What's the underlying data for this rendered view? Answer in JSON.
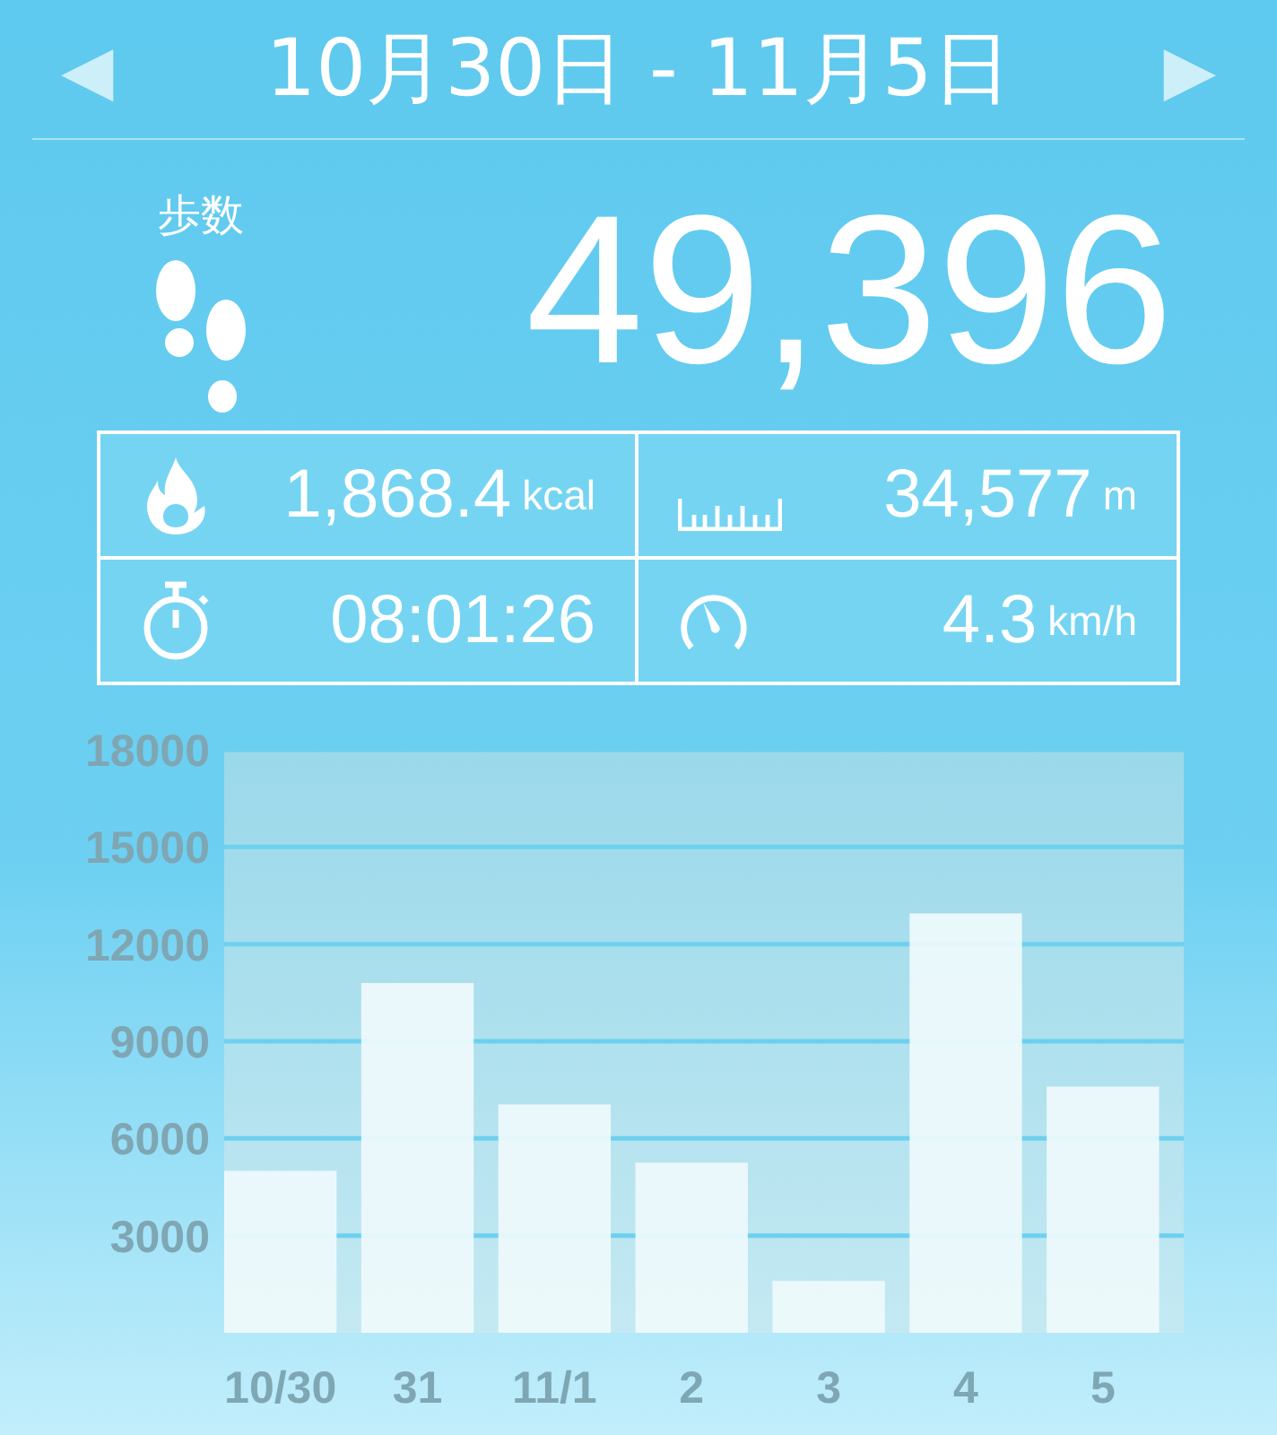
{
  "header": {
    "prev_label": "◀",
    "title": "10月30日 - 11月5日",
    "next_label": "▶"
  },
  "steps": {
    "label": "歩数",
    "value": "49,396"
  },
  "stats": [
    {
      "kind": "calories",
      "value": "1,868.4",
      "unit": "kcal"
    },
    {
      "kind": "distance",
      "value": "34,577",
      "unit": "m"
    },
    {
      "kind": "time",
      "value": "08:01:26"
    },
    {
      "kind": "speed",
      "value": "4.3",
      "unit": "km/h"
    }
  ],
  "chart": {
    "chart_data": {
      "type": "bar",
      "categories": [
        "10/30",
        "31",
        "11/1",
        "2",
        "3",
        "4",
        "5"
      ],
      "values": [
        5000,
        10800,
        7050,
        5250,
        1600,
        12950,
        7600
      ],
      "ylim": [
        0,
        18000
      ],
      "grid": true,
      "yticks": [
        3000,
        6000,
        9000,
        12000,
        15000,
        18000
      ]
    }
  }
}
